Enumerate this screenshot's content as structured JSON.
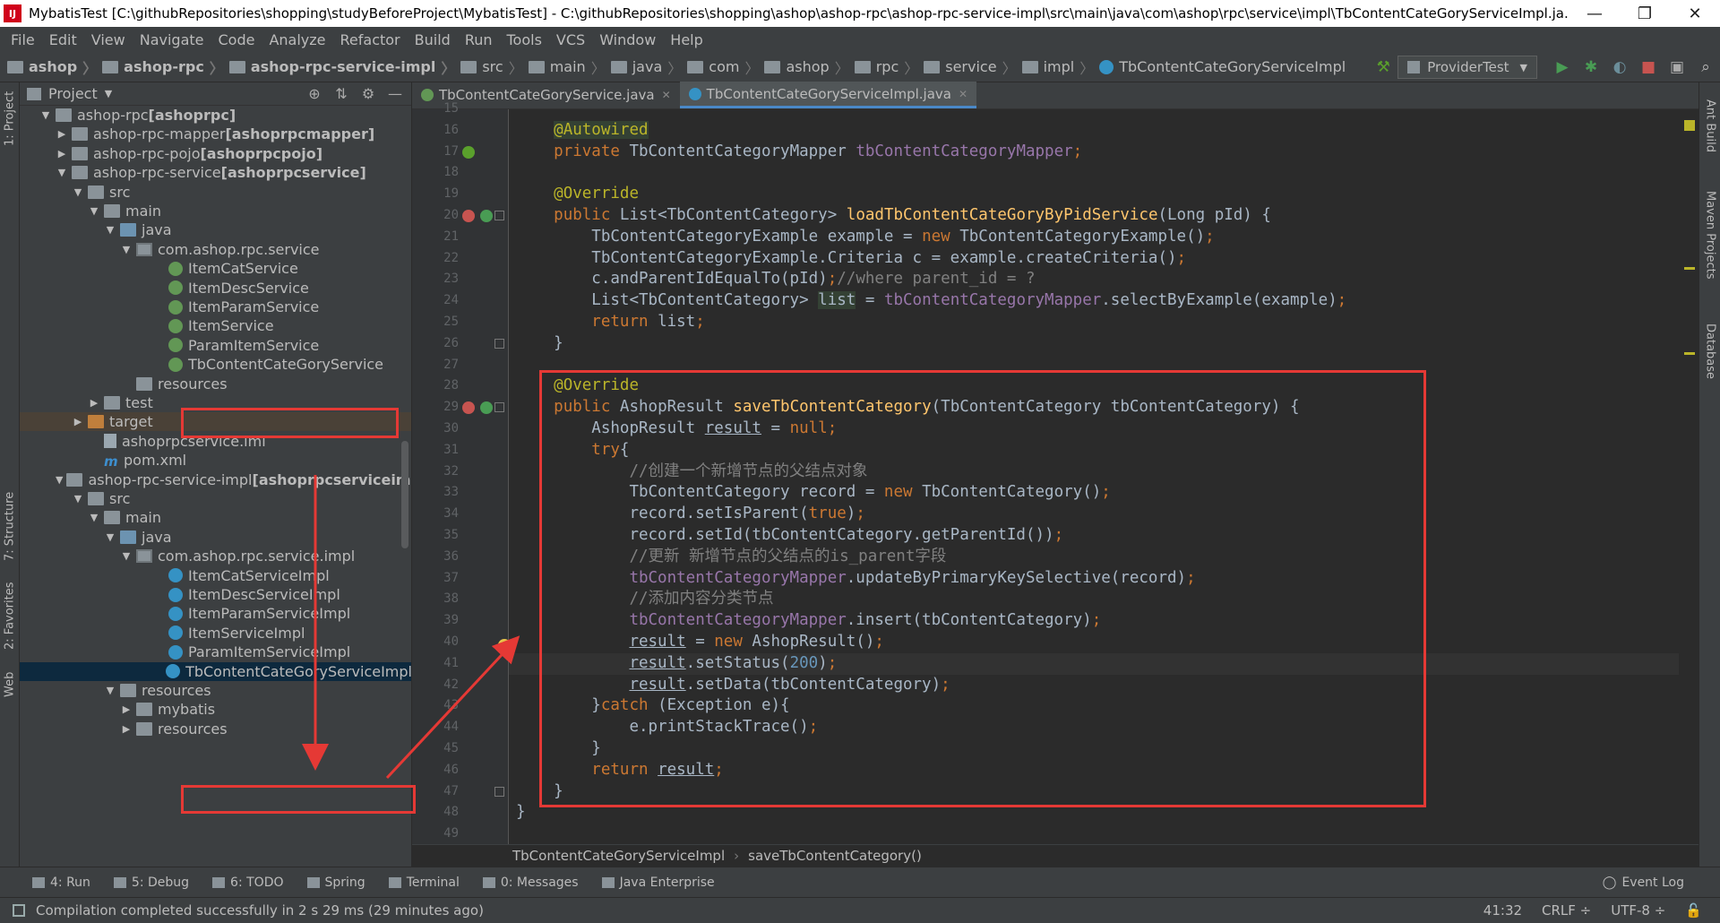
{
  "window": {
    "title": "MybatisTest [C:\\githubRepositories\\shopping\\studyBeforeProject\\MybatisTest] - C:\\githubRepositories\\shopping\\ashop\\ashop-rpc\\ashop-rpc-service-impl\\src\\main\\java\\com\\ashop\\rpc\\service\\impl\\TbContentCateGoryServiceImpl.ja...",
    "app_icon": "IJ",
    "minimize": "—",
    "maximize": "❐",
    "close": "✕"
  },
  "menu": [
    "File",
    "Edit",
    "View",
    "Navigate",
    "Code",
    "Analyze",
    "Refactor",
    "Build",
    "Run",
    "Tools",
    "VCS",
    "Window",
    "Help"
  ],
  "navbar": {
    "crumbs": [
      "ashop",
      "ashop-rpc",
      "ashop-rpc-service-impl",
      "src",
      "main",
      "java",
      "com",
      "ashop",
      "rpc",
      "service",
      "impl",
      "TbContentCateGoryServiceImpl"
    ],
    "run_config": "ProviderTest"
  },
  "left_strip": {
    "project_tab": "1: Project",
    "structure_tab": "7: Structure",
    "favorites_tab": "2: Favorites",
    "web_tab": "Web"
  },
  "right_strip": {
    "ant_tab": "Ant Build",
    "maven_tab": "Maven Projects",
    "database_tab": "Database"
  },
  "project_panel": {
    "title": "Project",
    "tree": [
      {
        "label": "ashop-rpc ",
        "bold": "[ashoprpc]",
        "icon": "folder",
        "arrow": "▼"
      },
      {
        "label": "ashop-rpc-mapper ",
        "bold": "[ashoprpcmapper]",
        "icon": "folder",
        "arrow": "▶"
      },
      {
        "label": "ashop-rpc-pojo ",
        "bold": "[ashoprpcpojo]",
        "icon": "folder",
        "arrow": "▶"
      },
      {
        "label": "ashop-rpc-service ",
        "bold": "[ashoprpcservice]",
        "icon": "folder",
        "arrow": "▼"
      },
      {
        "label": "src",
        "bold": "",
        "icon": "folder",
        "arrow": "▼"
      },
      {
        "label": "main",
        "bold": "",
        "icon": "folder",
        "arrow": "▼"
      },
      {
        "label": "java",
        "bold": "",
        "icon": "folder-src",
        "arrow": "▼"
      },
      {
        "label": "com.ashop.rpc.service",
        "bold": "",
        "icon": "package",
        "arrow": "▼"
      },
      {
        "label": "ItemCatService",
        "bold": "",
        "icon": "iface",
        "arrow": ""
      },
      {
        "label": "ItemDescService",
        "bold": "",
        "icon": "iface",
        "arrow": ""
      },
      {
        "label": "ItemParamService",
        "bold": "",
        "icon": "iface",
        "arrow": ""
      },
      {
        "label": "ItemService",
        "bold": "",
        "icon": "iface",
        "arrow": ""
      },
      {
        "label": "ParamItemService",
        "bold": "",
        "icon": "iface",
        "arrow": ""
      },
      {
        "label": "TbContentCateGoryService",
        "bold": "",
        "icon": "iface",
        "arrow": ""
      },
      {
        "label": "resources",
        "bold": "",
        "icon": "folder",
        "arrow": ""
      },
      {
        "label": "test",
        "bold": "",
        "icon": "folder",
        "arrow": "▶"
      },
      {
        "label": "target",
        "bold": "",
        "icon": "folder-target",
        "arrow": "▶"
      },
      {
        "label": "ashoprpcservice.iml",
        "bold": "",
        "icon": "iml",
        "arrow": ""
      },
      {
        "label": "pom.xml",
        "bold": "",
        "icon": "maven",
        "arrow": ""
      },
      {
        "label": "ashop-rpc-service-impl ",
        "bold": "[ashoprpcserviceimpl]",
        "icon": "folder",
        "arrow": "▼"
      },
      {
        "label": "src",
        "bold": "",
        "icon": "folder",
        "arrow": "▼"
      },
      {
        "label": "main",
        "bold": "",
        "icon": "folder",
        "arrow": "▼"
      },
      {
        "label": "java",
        "bold": "",
        "icon": "folder-src",
        "arrow": "▼"
      },
      {
        "label": "com.ashop.rpc.service.impl",
        "bold": "",
        "icon": "package",
        "arrow": "▼"
      },
      {
        "label": "ItemCatServiceImpl",
        "bold": "",
        "icon": "klass",
        "arrow": ""
      },
      {
        "label": "ItemDescServiceImpl",
        "bold": "",
        "icon": "klass",
        "arrow": ""
      },
      {
        "label": "ItemParamServiceImpl",
        "bold": "",
        "icon": "klass",
        "arrow": ""
      },
      {
        "label": "ItemServiceImpl",
        "bold": "",
        "icon": "klass",
        "arrow": ""
      },
      {
        "label": "ParamItemServiceImpl",
        "bold": "",
        "icon": "klass",
        "arrow": ""
      },
      {
        "label": "TbContentCateGoryServiceImpl",
        "bold": "",
        "icon": "klass",
        "arrow": ""
      },
      {
        "label": "resources",
        "bold": "",
        "icon": "folder",
        "arrow": "▼"
      },
      {
        "label": "mybatis",
        "bold": "",
        "icon": "folder",
        "arrow": "▶"
      },
      {
        "label": "resources",
        "bold": "",
        "icon": "folder",
        "arrow": "▶"
      }
    ]
  },
  "tabs": [
    {
      "label": "TbContentCateGoryService.java",
      "icon": "interface-icon",
      "active": false
    },
    {
      "label": "TbContentCateGoryServiceImpl.java",
      "icon": "class-icon",
      "active": true
    }
  ],
  "editor": {
    "first_line": 15,
    "current_line": 41,
    "lines": [
      [
        [
          "",
          "tx"
        ]
      ],
      [
        [
          "    ",
          "tx"
        ],
        [
          "@Autowired",
          "an hl"
        ]
      ],
      [
        [
          "    ",
          "tx"
        ],
        [
          "private ",
          "kw"
        ],
        [
          "TbContentCategoryMapper ",
          "tx"
        ],
        [
          "tbContentCategoryMapper",
          "fd"
        ],
        [
          ";",
          "kw"
        ]
      ],
      [
        [
          "",
          "tx"
        ]
      ],
      [
        [
          "    ",
          "tx"
        ],
        [
          "@Override",
          "an"
        ]
      ],
      [
        [
          "    ",
          "tx"
        ],
        [
          "public ",
          "kw"
        ],
        [
          "List<TbContentCategory> ",
          "tx"
        ],
        [
          "loadTbContentCateGoryByPidService",
          "fn"
        ],
        [
          "(Long pId) {",
          "tx"
        ]
      ],
      [
        [
          "        ",
          "tx"
        ],
        [
          "TbContentCategoryExample example = ",
          "tx"
        ],
        [
          "new ",
          "kw"
        ],
        [
          "TbContentCategoryExample()",
          "tx"
        ],
        [
          ";",
          "kw"
        ]
      ],
      [
        [
          "        ",
          "tx"
        ],
        [
          "TbContentCategoryExample.Criteria c = example.createCriteria()",
          "tx"
        ],
        [
          ";",
          "kw"
        ]
      ],
      [
        [
          "        ",
          "tx"
        ],
        [
          "c.andParentIdEqualTo(pId)",
          "tx"
        ],
        [
          ";",
          "kw"
        ],
        [
          "//where parent_id = ?",
          "cm"
        ]
      ],
      [
        [
          "        ",
          "tx"
        ],
        [
          "List<TbContentCategory> ",
          "tx"
        ],
        [
          "list",
          "tx hl"
        ],
        [
          " = ",
          "tx"
        ],
        [
          "tbContentCategoryMapper",
          "fd"
        ],
        [
          ".selectByExample(example)",
          "tx"
        ],
        [
          ";",
          "kw"
        ]
      ],
      [
        [
          "        ",
          "tx"
        ],
        [
          "return ",
          "kw"
        ],
        [
          "list",
          "tx"
        ],
        [
          ";",
          "kw"
        ]
      ],
      [
        [
          "    ",
          "tx"
        ],
        [
          "}",
          "tx"
        ]
      ],
      [
        [
          "",
          "tx"
        ]
      ],
      [
        [
          "    ",
          "tx"
        ],
        [
          "@Override",
          "an"
        ]
      ],
      [
        [
          "    ",
          "tx"
        ],
        [
          "public ",
          "kw"
        ],
        [
          "AshopResult ",
          "tx"
        ],
        [
          "saveTbContentCategory",
          "fn"
        ],
        [
          "(TbContentCategory tbContentCategory) {",
          "tx"
        ]
      ],
      [
        [
          "        ",
          "tx"
        ],
        [
          "AshopResult ",
          "tx"
        ],
        [
          "result",
          "tx ul"
        ],
        [
          " = ",
          "tx"
        ],
        [
          "null",
          "kw"
        ],
        [
          ";",
          "kw"
        ]
      ],
      [
        [
          "        ",
          "tx"
        ],
        [
          "try",
          "kw"
        ],
        [
          "{",
          "tx"
        ]
      ],
      [
        [
          "            ",
          "tx"
        ],
        [
          "//创建一个新增节点的父结点对象",
          "cm"
        ]
      ],
      [
        [
          "            ",
          "tx"
        ],
        [
          "TbContentCategory record = ",
          "tx"
        ],
        [
          "new ",
          "kw"
        ],
        [
          "TbContentCategory()",
          "tx"
        ],
        [
          ";",
          "kw"
        ]
      ],
      [
        [
          "            ",
          "tx"
        ],
        [
          "record.setIsParent(",
          "tx"
        ],
        [
          "true",
          "kw"
        ],
        [
          ")",
          "tx"
        ],
        [
          ";",
          "kw"
        ]
      ],
      [
        [
          "            ",
          "tx"
        ],
        [
          "record.setId(tbContentCategory.getParentId())",
          "tx"
        ],
        [
          ";",
          "kw"
        ]
      ],
      [
        [
          "            ",
          "tx"
        ],
        [
          "//更新 新增节点的父结点的is_parent字段",
          "cm"
        ]
      ],
      [
        [
          "            ",
          "tx"
        ],
        [
          "tbContentCategoryMapper",
          "fd"
        ],
        [
          ".updateByPrimaryKeySelective(record)",
          "tx"
        ],
        [
          ";",
          "kw"
        ]
      ],
      [
        [
          "            ",
          "tx"
        ],
        [
          "//添加内容分类节点",
          "cm"
        ]
      ],
      [
        [
          "            ",
          "tx"
        ],
        [
          "tbContentCategoryMapper",
          "fd"
        ],
        [
          ".insert(tbContentCategory)",
          "tx"
        ],
        [
          ";",
          "kw"
        ]
      ],
      [
        [
          "            ",
          "tx"
        ],
        [
          "result",
          "tx ul"
        ],
        [
          " = ",
          "tx"
        ],
        [
          "new ",
          "kw"
        ],
        [
          "AshopResult()",
          "tx"
        ],
        [
          ";",
          "kw"
        ]
      ],
      [
        [
          "            ",
          "tx"
        ],
        [
          "result",
          "tx ul"
        ],
        [
          ".setStatus(",
          "tx"
        ],
        [
          "200",
          "num"
        ],
        [
          ")",
          "tx"
        ],
        [
          ";",
          "kw"
        ]
      ],
      [
        [
          "            ",
          "tx"
        ],
        [
          "result",
          "tx ul"
        ],
        [
          ".setData(tbContentCategory)",
          "tx"
        ],
        [
          ";",
          "kw"
        ]
      ],
      [
        [
          "        ",
          "tx"
        ],
        [
          "}",
          "tx"
        ],
        [
          "catch ",
          "kw"
        ],
        [
          "(Exception e){",
          "tx"
        ]
      ],
      [
        [
          "            ",
          "tx"
        ],
        [
          "e.printStackTrace()",
          "tx"
        ],
        [
          ";",
          "kw"
        ]
      ],
      [
        [
          "        ",
          "tx"
        ],
        [
          "}",
          "tx"
        ]
      ],
      [
        [
          "        ",
          "tx"
        ],
        [
          "return ",
          "kw"
        ],
        [
          "result",
          "tx ul"
        ],
        [
          ";",
          "kw"
        ]
      ],
      [
        [
          "    ",
          "tx"
        ],
        [
          "}",
          "tx"
        ]
      ],
      [
        [
          "}",
          "tx"
        ]
      ],
      [
        [
          "",
          "tx"
        ]
      ]
    ]
  },
  "editor_breadcrumb": [
    "TbContentCateGoryServiceImpl",
    "saveTbContentCategory()"
  ],
  "bottom_tools": [
    {
      "label": "4: Run",
      "name": "run-tool-button"
    },
    {
      "label": "5: Debug",
      "name": "debug-tool-button"
    },
    {
      "label": "6: TODO",
      "name": "todo-tool-button"
    },
    {
      "label": "Spring",
      "name": "spring-tool-button"
    },
    {
      "label": "Terminal",
      "name": "terminal-tool-button"
    },
    {
      "label": "0: Messages",
      "name": "messages-tool-button"
    },
    {
      "label": "Java Enterprise",
      "name": "java-enterprise-tool-button"
    }
  ],
  "event_log": "Event Log",
  "status": {
    "message": "Compilation completed successfully in 2 s 29 ms (29 minutes ago)",
    "position": "41:32",
    "line_sep": "CRLF ÷",
    "encoding": "UTF-8 ÷"
  },
  "colors": {
    "annotation_red": "#e53935",
    "selection_blue": "#0d293e",
    "editor_bg": "#2b2b2b",
    "panel_bg": "#3c3f41"
  }
}
